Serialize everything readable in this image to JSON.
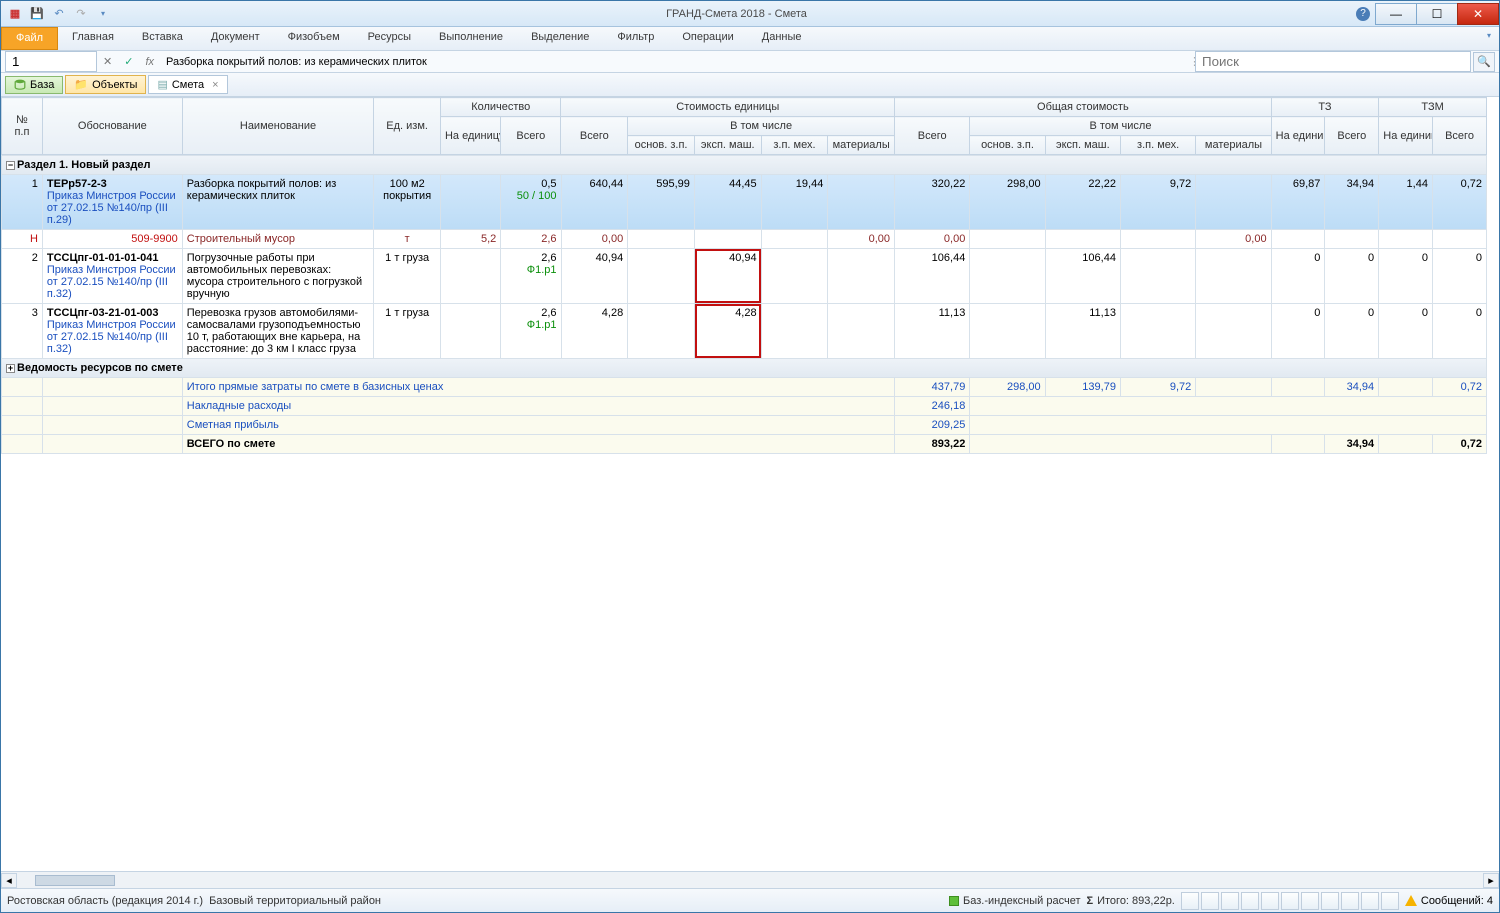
{
  "title": "ГРАНД-Смета 2018 - Смета",
  "ribbon": {
    "file": "Файл",
    "tabs": [
      "Главная",
      "Вставка",
      "Документ",
      "Физобъем",
      "Ресурсы",
      "Выполнение",
      "Выделение",
      "Фильтр",
      "Операции",
      "Данные"
    ]
  },
  "fbar": {
    "namebox": "1",
    "fx": "fx",
    "formula": "Разборка покрытий полов: из керамических плиток",
    "search_placeholder": "Поиск"
  },
  "nav": {
    "base": "База",
    "obj": "Объекты",
    "doc": "Смета"
  },
  "headers": {
    "npp": "№\nп.п",
    "obos": "Обоснование",
    "naim": "Наименование",
    "ed": "Ед. изм.",
    "kol": "Количество",
    "kol_unit": "На единицу",
    "kol_all": "Всего",
    "cost_unit": "Стоимость единицы",
    "cost_all": "Общая стоимость",
    "tz": "ТЗ",
    "tzm": "ТЗМ",
    "vtom": "В том числе",
    "osn": "основ. з.п.",
    "maw": "эксп. маш.",
    "mex": "з.п. мех.",
    "mat": "материалы",
    "na_ed": "На единицу",
    "vs": "Всего"
  },
  "section1": "Раздел 1. Новый раздел",
  "section2": "Ведомость ресурсов по смете",
  "rows": [
    {
      "n": "1",
      "code": "ТЕРр57-2-3",
      "sub": "Приказ Минстроя России от 27.02.15 №140/пр (III п.29)",
      "name": "Разборка покрытий полов: из керамических плиток",
      "ed": "100 м2 покрытия",
      "k1": "0,5",
      "k2": "50 / 100",
      "c_all": "640,44",
      "c_osn": "595,99",
      "c_maw": "44,45",
      "c_mex": "19,44",
      "c_mat": "",
      "o_all": "320,22",
      "o_osn": "298,00",
      "o_maw": "22,22",
      "o_mex": "9,72",
      "o_mat": "",
      "tz_e": "69,87",
      "tz_v": "34,94",
      "tzm_e": "1,44",
      "tzm_v": "0,72"
    },
    {
      "ntag": "Н",
      "code": "509-9900",
      "name": "Строительный мусор",
      "ed": "т",
      "k1": "5,2",
      "k2": "2,6",
      "c_all": "0,00",
      "c_mat": "0,00",
      "o_all": "0,00",
      "o_mat": "0,00"
    },
    {
      "n": "2",
      "code": "ТССЦпг-01-01-01-041",
      "sub": "Приказ Минстроя России от 27.02.15 №140/пр (III п.32)",
      "name": "Погрузочные работы при автомобильных перевозках: мусора строительного с погрузкой вручную",
      "ed": "1 т груза",
      "k1": "2,6",
      "k3": "Ф1.р1",
      "c_all": "40,94",
      "c_maw": "40,94",
      "o_all": "106,44",
      "o_maw": "106,44",
      "tz_e": "0",
      "tz_v": "0",
      "tzm_e": "0",
      "tzm_v": "0"
    },
    {
      "n": "3",
      "code": "ТССЦпг-03-21-01-003",
      "sub": "Приказ Минстроя России от 27.02.15 №140/пр (III п.32)",
      "name": "Перевозка грузов автомобилями-самосвалами грузоподъемностью 10 т, работающих вне карьера, на расстояние: до 3 км I класс груза",
      "ed": "1 т груза",
      "k1": "2,6",
      "k3": "Ф1.р1",
      "c_all": "4,28",
      "c_maw": "4,28",
      "o_all": "11,13",
      "o_maw": "11,13",
      "tz_e": "0",
      "tz_v": "0",
      "tzm_e": "0",
      "tzm_v": "0"
    }
  ],
  "totals": [
    {
      "label": "Итого прямые затраты по смете в базисных ценах",
      "o_all": "437,79",
      "o_osn": "298,00",
      "o_maw": "139,79",
      "o_mex": "9,72",
      "tz_v": "34,94",
      "tzm_v": "0,72"
    },
    {
      "label": "Накладные расходы",
      "o_all": "246,18"
    },
    {
      "label": "Сметная прибыль",
      "o_all": "209,25"
    },
    {
      "label": "ВСЕГО по смете",
      "o_all": "893,22",
      "tz_v": "34,94",
      "tzm_v": "0,72",
      "bold": true
    }
  ],
  "status": {
    "left1": "Ростовская область (редакция 2014 г.)",
    "left2": "Базовый территориальный район",
    "calc": "Баз.-индексный расчет",
    "sum": "Итого: 893,22р.",
    "msgs": "Сообщений: 4"
  }
}
